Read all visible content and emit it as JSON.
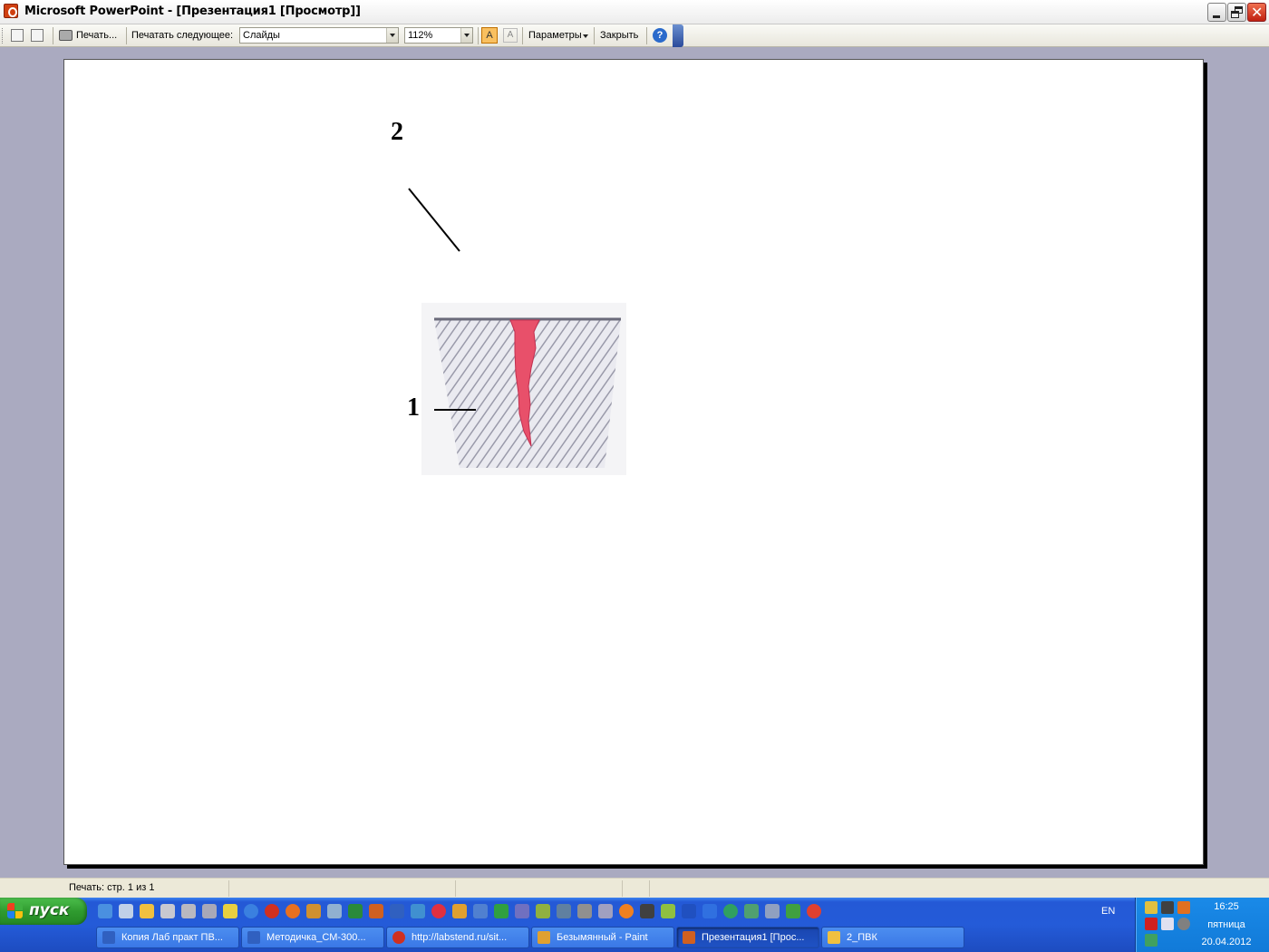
{
  "window": {
    "title": "Microsoft PowerPoint - [Презентация1 [Просмотр]]"
  },
  "toolbar": {
    "print_label": "Печать...",
    "print_what_label": "Печатать следующее:",
    "print_what_value": "Слайды",
    "zoom_value": "112%",
    "options_label": "Параметры",
    "close_label": "Закрыть",
    "color_option_label": "A",
    "grayscale_option_label": "A",
    "help_label": "?"
  },
  "slide": {
    "label_top": "2",
    "label_left": "1",
    "weld_color": "#e8506a",
    "hatch_color": "#b8b8c8"
  },
  "status": {
    "text": "Печать: стр. 1 из 1"
  },
  "taskbar": {
    "start_label": "пуск",
    "tasks": [
      {
        "label": "Копия Лаб практ ПВ...",
        "icon": "word-icon"
      },
      {
        "label": "Методичка_СМ-300...",
        "icon": "word-icon"
      },
      {
        "label": "http://labstend.ru/sit...",
        "icon": "opera-icon"
      },
      {
        "label": "Безымянный - Paint",
        "icon": "paint-icon"
      },
      {
        "label": "Презентация1 [Прос...",
        "icon": "powerpoint-icon"
      },
      {
        "label": "2_ПВК",
        "icon": "folder-icon"
      }
    ],
    "language": "EN",
    "clock_time": "16:25",
    "clock_day": "пятница",
    "clock_date": "20.04.2012"
  },
  "colors": {
    "accent_titlebar": "#ffffff",
    "taskbar_blue": "#245bd8",
    "start_green": "#2f9b2f",
    "tray_blue": "#117ad8"
  }
}
